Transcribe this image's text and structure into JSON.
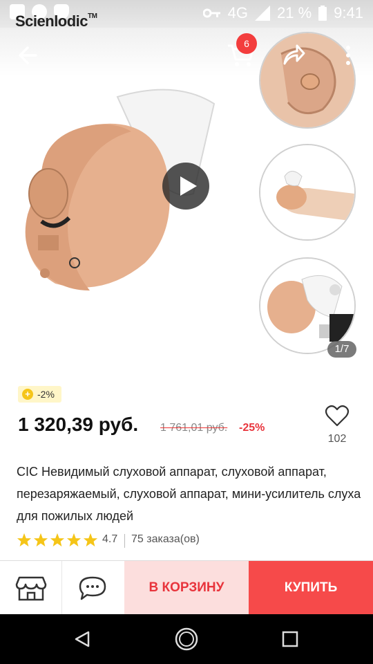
{
  "status_bar": {
    "network": "4G",
    "battery": "21 %",
    "time": "9:41"
  },
  "brand": {
    "name": "Scienlodic",
    "tm": "TM"
  },
  "header": {
    "cart_count": "6"
  },
  "gallery": {
    "counter": "1/7"
  },
  "price_block": {
    "coin_discount": "-2%",
    "price": "1 320,39 руб.",
    "old_price": "1 761,01 руб.",
    "discount": "-25%",
    "favorites": "102"
  },
  "product": {
    "title": "CIC Невидимый слуховой аппарат, слуховой аппарат, перезаряжаемый, слуховой аппарат, мини-усилитель слуха для пожилых людей",
    "rating": "4.7",
    "stars": 5,
    "orders": "75 заказа(ов)"
  },
  "actions": {
    "to_cart": "В КОРЗИНУ",
    "buy": "КУПИТЬ"
  },
  "colors": {
    "accent": "#f64a4a",
    "accent_light": "#fcdedd",
    "star": "#f5c518"
  },
  "icons": [
    "back-arrow-icon",
    "cart-icon",
    "share-icon",
    "more-icon",
    "play-icon",
    "heart-icon",
    "store-icon",
    "chat-icon",
    "coin-icon",
    "star-icon",
    "nav-back-icon",
    "nav-home-icon",
    "nav-recents-icon"
  ]
}
